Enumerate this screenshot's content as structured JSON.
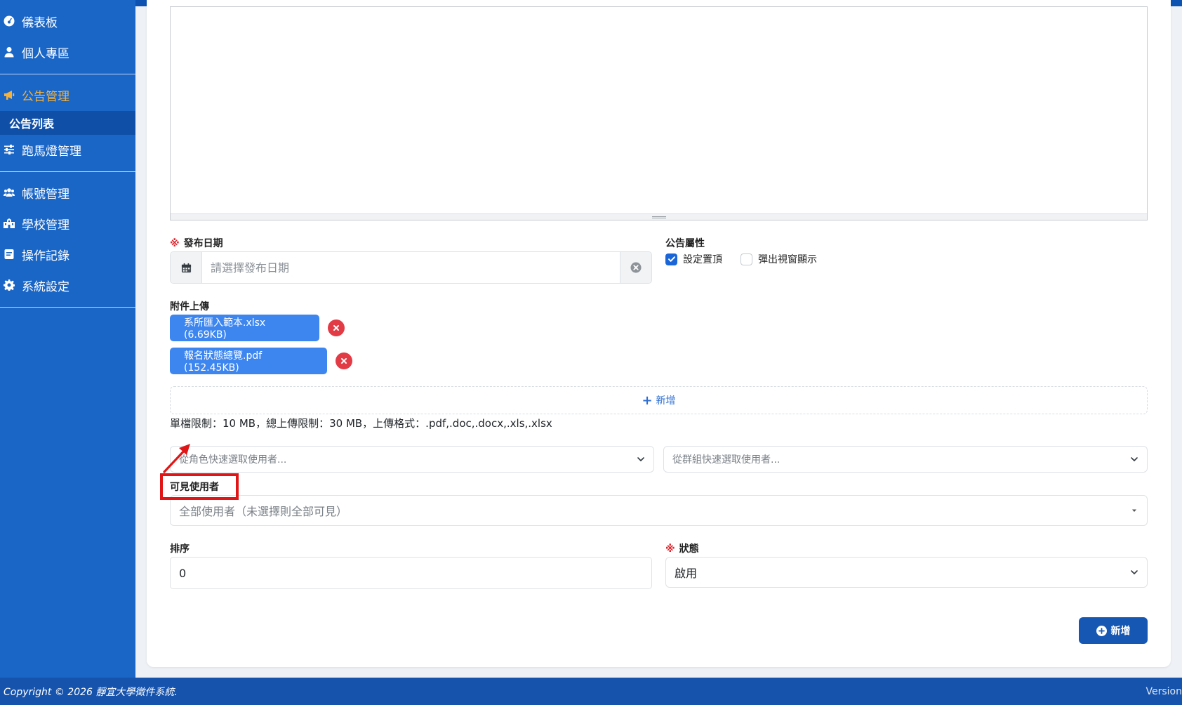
{
  "sidebar": {
    "items": [
      {
        "label": "儀表板",
        "icon": "dashboard-icon"
      },
      {
        "label": "個人專區",
        "icon": "user-icon"
      },
      {
        "label": "公告管理",
        "icon": "bullhorn-icon",
        "active": true
      },
      {
        "label": "公告列表",
        "sub": true
      },
      {
        "label": "跑馬燈管理",
        "icon": "sliders-icon"
      },
      {
        "label": "帳號管理",
        "icon": "users-icon"
      },
      {
        "label": "學校管理",
        "icon": "school-icon"
      },
      {
        "label": "操作記錄",
        "icon": "log-icon"
      },
      {
        "label": "系統設定",
        "icon": "gear-icon"
      }
    ]
  },
  "form": {
    "required_mark": "※",
    "publish_date": {
      "label": "發布日期",
      "placeholder": "請選擇發布日期"
    },
    "attributes": {
      "label": "公告屬性",
      "options": [
        {
          "label": "設定置頂",
          "checked": true
        },
        {
          "label": "彈出視窗顯示",
          "checked": false
        }
      ]
    },
    "attachments": {
      "label": "附件上傳",
      "files": [
        "系所匯入範本.xlsx (6.69KB)",
        "報名狀態總覽.pdf (152.45KB)"
      ],
      "add_label": "新增",
      "hint": "單檔限制：10 MB，總上傳限制：30 MB，上傳格式：.pdf,.doc,.docx,.xls,.xlsx"
    },
    "role_select_placeholder": "從角色快速選取使用者...",
    "group_select_placeholder": "從群組快速選取使用者...",
    "visible_users": {
      "label": "可見使用者",
      "placeholder": "全部使用者（未選擇則全部可見）"
    },
    "order": {
      "label": "排序",
      "value": "0"
    },
    "status": {
      "label": "狀態",
      "value": "啟用"
    },
    "submit_label": "新增"
  },
  "footer": {
    "copyright": "Copyright © 2026 靜宜大學徵件系統.",
    "version": "Version"
  },
  "colors": {
    "sidebar": "#1a66c7",
    "active": "#f4b23d",
    "primary": "#1557b3",
    "file_button": "#3d86f0",
    "danger": "#e23b45",
    "annotation": "#e01616"
  }
}
